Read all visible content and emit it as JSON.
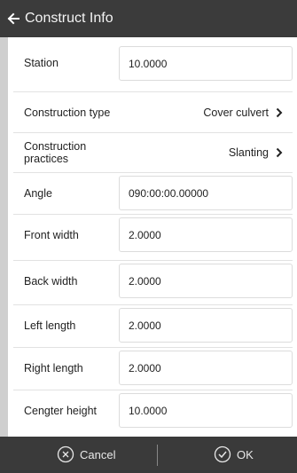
{
  "header": {
    "title": "Construct Info"
  },
  "fields": {
    "station": {
      "label": "Station",
      "value": "10.0000"
    },
    "construction_type": {
      "label": "Construction type",
      "value": "Cover culvert"
    },
    "construction_practices": {
      "label": "Construction practices",
      "value": "Slanting"
    },
    "angle": {
      "label": "Angle",
      "value": "090:00:00.00000"
    },
    "front_width": {
      "label": "Front width",
      "value": "2.0000"
    },
    "back_width": {
      "label": "Back width",
      "value": "2.0000"
    },
    "left_length": {
      "label": "Left length",
      "value": "2.0000"
    },
    "right_length": {
      "label": "Right length",
      "value": "2.0000"
    },
    "center_height": {
      "label": "Cengter height",
      "value": "10.0000"
    }
  },
  "footer": {
    "cancel_label": "Cancel",
    "ok_label": "OK"
  },
  "colors": {
    "header_bg": "#3b3b3b",
    "footer_bg": "#3a3a3a",
    "card_bg": "#ffffff"
  }
}
